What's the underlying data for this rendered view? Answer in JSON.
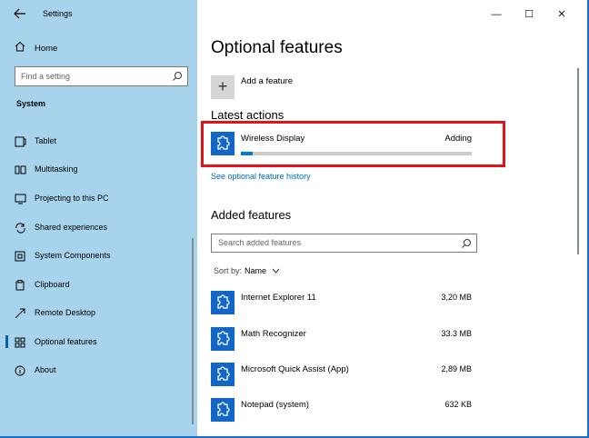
{
  "window": {
    "app_title": "Settings",
    "controls": {
      "minimize": "—",
      "maximize": "☐",
      "close": "✕"
    }
  },
  "sidebar": {
    "back_icon": "back-arrow-icon",
    "home_label": "Home",
    "search_placeholder": "Find a setting",
    "section": "System",
    "items": [
      {
        "label": "Tablet",
        "icon": "tablet-icon"
      },
      {
        "label": "Multitasking",
        "icon": "multitasking-icon"
      },
      {
        "label": "Projecting to this PC",
        "icon": "projecting-icon"
      },
      {
        "label": "Shared experiences",
        "icon": "shared-experiences-icon"
      },
      {
        "label": "System Components",
        "icon": "system-components-icon"
      },
      {
        "label": "Clipboard",
        "icon": "clipboard-icon"
      },
      {
        "label": "Remote Desktop",
        "icon": "remote-desktop-icon"
      },
      {
        "label": "Optional features",
        "icon": "optional-features-icon",
        "selected": true
      },
      {
        "label": "About",
        "icon": "info-icon"
      }
    ]
  },
  "main": {
    "title": "Optional features",
    "add_feature_label": "Add a feature",
    "latest_actions_heading": "Latest actions",
    "latest_action": {
      "name": "Wireless Display",
      "status": "Adding",
      "progress": 0.05
    },
    "history_link": "See optional feature history",
    "added_features_heading": "Added features",
    "added_search_placeholder": "Search added features",
    "sort_label": "Sort by:",
    "sort_value": "Name",
    "features": [
      {
        "name": "Internet Explorer 11",
        "size": "3,20 MB"
      },
      {
        "name": "Math Recognizer",
        "size": "33.3 MB"
      },
      {
        "name": "Microsoft Quick Assist (App)",
        "size": "2,89 MB"
      },
      {
        "name": "Notepad (system)",
        "size": "632 KB"
      }
    ]
  },
  "colors": {
    "sidebar_bg": "#a7d3ec",
    "accent": "#0078d7",
    "feature_icon_bg": "#1166c6",
    "highlight": "#e2121b",
    "link": "#0066b4"
  }
}
